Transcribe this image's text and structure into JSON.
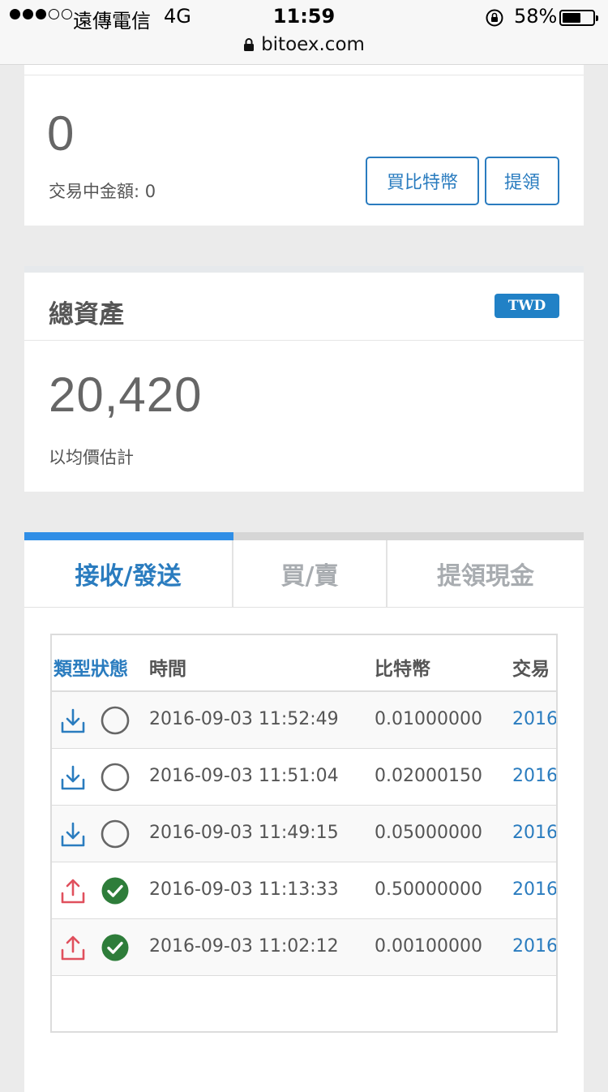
{
  "status_bar": {
    "carrier": "遠傳電信",
    "network": "4G",
    "time": "11:59",
    "battery_percent": "58%",
    "url": "bitoex.com"
  },
  "balance_card": {
    "amount": "0",
    "in_trade_label": "交易中金額: 0",
    "buy_button": "買比特幣",
    "withdraw_button": "提領"
  },
  "total_assets": {
    "title": "總資產",
    "currency_badge": "TWD",
    "value": "20,420",
    "note": "以均價估計"
  },
  "tabs": [
    {
      "label": "接收/發送",
      "active": true
    },
    {
      "label": "買/賣",
      "active": false
    },
    {
      "label": "提領現金",
      "active": false
    }
  ],
  "table": {
    "headers": {
      "type_status": "類型狀態",
      "time": "時間",
      "btc": "比特幣",
      "tx": "交易"
    },
    "rows": [
      {
        "type": "receive",
        "status": "pending",
        "time": "2016-09-03 11:52:49",
        "btc": "0.01000000",
        "tx": "2016"
      },
      {
        "type": "receive",
        "status": "pending",
        "time": "2016-09-03 11:51:04",
        "btc": "0.02000150",
        "tx": "2016"
      },
      {
        "type": "receive",
        "status": "pending",
        "time": "2016-09-03 11:49:15",
        "btc": "0.05000000",
        "tx": "2016"
      },
      {
        "type": "send",
        "status": "completed",
        "time": "2016-09-03 11:13:33",
        "btc": "0.50000000",
        "tx": "2016"
      },
      {
        "type": "send",
        "status": "completed",
        "time": "2016-09-03 11:02:12",
        "btc": "0.00100000",
        "tx": "2016"
      }
    ]
  },
  "colors": {
    "accent": "#2a7cbf",
    "tab_active": "#2f8ee6",
    "send_icon": "#e0505d",
    "completed": "#2e7d3a",
    "pending": "#666666"
  },
  "icons": {
    "receive": "download-tray-icon",
    "send": "upload-tray-icon",
    "pending": "empty-circle-icon",
    "completed": "check-circle-icon"
  }
}
